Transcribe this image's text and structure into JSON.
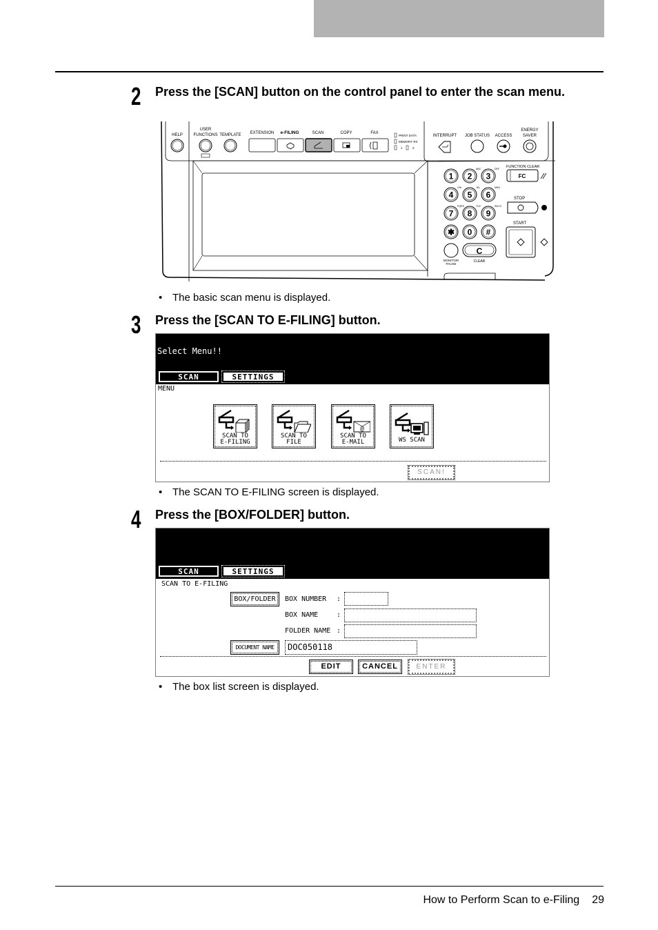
{
  "page": {
    "footer_title": "How to Perform Scan to e-Filing",
    "page_number": "29"
  },
  "steps": [
    {
      "number": "2",
      "title": "Press the [SCAN] button on the control panel to enter the scan menu.",
      "note": "The basic scan menu is displayed."
    },
    {
      "number": "3",
      "title": "Press the [SCAN TO E-FILING] button.",
      "note": "The SCAN TO E-FILING screen is displayed."
    },
    {
      "number": "4",
      "title": "Press the [BOX/FOLDER] button.",
      "note": "The box list screen is displayed."
    }
  ],
  "control_panel": {
    "help": "HELP",
    "user_functions_1": "USER",
    "user_functions_2": "FUNCTIONS",
    "template": "TEMPLATE",
    "extension": "EXTENSION",
    "e_filing": "e-FILING",
    "scan": "SCAN",
    "copy": "COPY",
    "fax": "FAX",
    "indicator_print_data": "PRINT DATA",
    "indicator_memory_rx": "MEMORY RX",
    "indicator_line1": "1",
    "indicator_line2": "2",
    "interrupt": "INTERRUPT",
    "job_status": "JOB STATUS",
    "access": "ACCESS",
    "energy_saver_1": "ENERGY",
    "energy_saver_2": "SAVER",
    "function_clear": "FUNCTION CLEAR",
    "fc": "FC",
    "stop": "STOP",
    "start": "START",
    "monitor_pause_1": "MONITOR/",
    "monitor_pause_2": "PAUSE",
    "clear": "CLEAR",
    "clear_key": "C",
    "keypad": [
      {
        "key": "1",
        "sub": ""
      },
      {
        "key": "2",
        "sub": "ABC"
      },
      {
        "key": "3",
        "sub": "DEF"
      },
      {
        "key": "4",
        "sub": "GHI"
      },
      {
        "key": "5",
        "sub": "JKL"
      },
      {
        "key": "6",
        "sub": "MNO"
      },
      {
        "key": "7",
        "sub": "PQRS"
      },
      {
        "key": "8",
        "sub": "TUV"
      },
      {
        "key": "9",
        "sub": "WXYZ"
      },
      {
        "key": "✱",
        "sub": ""
      },
      {
        "key": "0",
        "sub": ""
      },
      {
        "key": "#",
        "sub": ""
      }
    ]
  },
  "screen_menu": {
    "title": "Select Menu!!",
    "tabs": [
      "SCAN",
      "SETTINGS"
    ],
    "section_label": "MENU",
    "icons": [
      {
        "line1": "SCAN TO",
        "line2": "E-FILING",
        "icon": "e-filing-box-icon"
      },
      {
        "line1": "SCAN TO",
        "line2": "FILE",
        "icon": "folder-icon"
      },
      {
        "line1": "SCAN TO",
        "line2": "E-MAIL",
        "icon": "email-icon"
      },
      {
        "line1": "",
        "line2": "WS SCAN",
        "icon": "computer-icon"
      }
    ],
    "scan_button": "SCAN!"
  },
  "screen_efiling": {
    "tabs": [
      "SCAN",
      "SETTINGS"
    ],
    "section_label": "SCAN TO E-FILING",
    "box_folder_button": "BOX/FOLDER",
    "box_number_label": "BOX NUMBER",
    "box_number_value": "",
    "box_name_label": "BOX NAME",
    "box_name_value": "",
    "folder_name_label": "FOLDER NAME",
    "folder_name_value": "",
    "document_name_button": "DOCUMENT NAME",
    "document_name_value": "DOC050118",
    "colon": ":",
    "edit_button": "EDIT",
    "cancel_button": "CANCEL",
    "enter_button": "ENTER"
  }
}
